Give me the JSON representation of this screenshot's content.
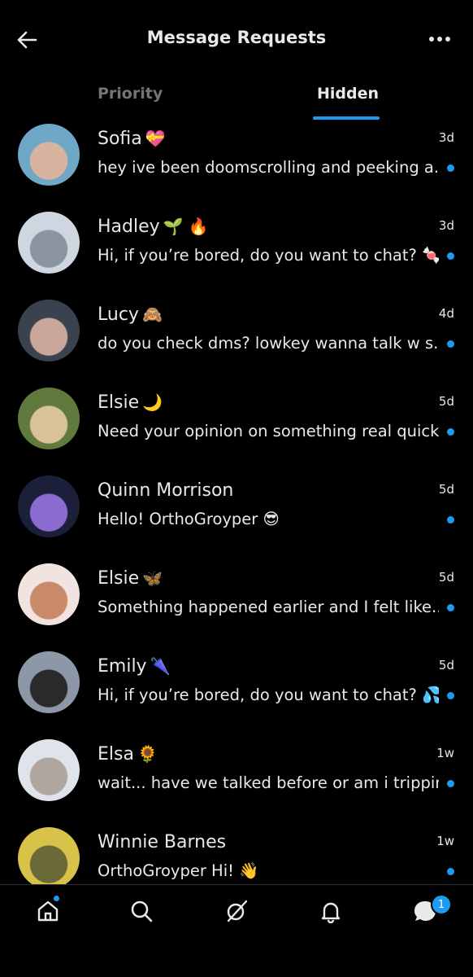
{
  "header": {
    "title": "Message Requests",
    "back_icon": "arrow-left-icon",
    "more_icon": "more-horizontal-icon"
  },
  "tabs": [
    {
      "label": "Priority",
      "active": false
    },
    {
      "label": "Hidden",
      "active": true
    }
  ],
  "colors": {
    "accent": "#1d9bf0",
    "background": "#000000",
    "text": "#e7e9ea",
    "muted": "#71767b"
  },
  "conversations": [
    {
      "name": "Sofia",
      "emoji": "💝",
      "time": "3d",
      "preview": "hey ive been doomscrolling and peeking a...",
      "unread": true,
      "avatar_colors": [
        "#6fa8c7",
        "#d8b4a0"
      ]
    },
    {
      "name": "Hadley",
      "emoji": "🌱 🔥",
      "time": "3d",
      "preview": "Hi, if you’re bored, do you want to chat? 🍬",
      "unread": true,
      "avatar_colors": [
        "#cfd6e0",
        "#8a93a0"
      ]
    },
    {
      "name": "Lucy",
      "emoji": "🙈",
      "time": "4d",
      "preview": "do you check dms? lowkey wanna talk w s...",
      "unread": true,
      "avatar_colors": [
        "#3a4250",
        "#c9a79a"
      ]
    },
    {
      "name": "Elsie",
      "emoji": "🌙",
      "time": "5d",
      "preview": "Need your opinion on something real quick",
      "unread": true,
      "avatar_colors": [
        "#5f7a3c",
        "#d9c29a"
      ]
    },
    {
      "name": "Quinn Morrison",
      "emoji": "",
      "time": "5d",
      "preview": "Hello!   OrthoGroyper 😎",
      "unread": true,
      "avatar_colors": [
        "#1b1f3a",
        "#8a6bd0"
      ]
    },
    {
      "name": "Elsie",
      "emoji": "🦋",
      "time": "5d",
      "preview": "Something happened earlier and I felt like...",
      "unread": true,
      "avatar_colors": [
        "#f1e4e0",
        "#c98a6a"
      ]
    },
    {
      "name": "Emily",
      "emoji": "🌂",
      "time": "5d",
      "preview": "Hi, if you’re bored, do you want to chat? 💦",
      "unread": true,
      "avatar_colors": [
        "#8c98a8",
        "#2a2a2a"
      ]
    },
    {
      "name": "Elsa",
      "emoji": "🌻",
      "time": "1w",
      "preview": "wait... have we talked before or am i tripping",
      "unread": true,
      "avatar_colors": [
        "#dfe3ea",
        "#b0a6a0"
      ]
    },
    {
      "name": "Winnie Barnes",
      "emoji": "",
      "time": "1w",
      "preview": "OrthoGroyper Hi!  👋",
      "unread": true,
      "avatar_colors": [
        "#d8c24a",
        "#6a6a38"
      ]
    }
  ],
  "bottom_nav": [
    {
      "name": "home-icon",
      "has_dot": true
    },
    {
      "name": "search-icon",
      "has_dot": false
    },
    {
      "name": "grok-icon",
      "has_dot": false
    },
    {
      "name": "bell-icon",
      "has_dot": false
    },
    {
      "name": "messages-icon",
      "badge": "1"
    }
  ]
}
